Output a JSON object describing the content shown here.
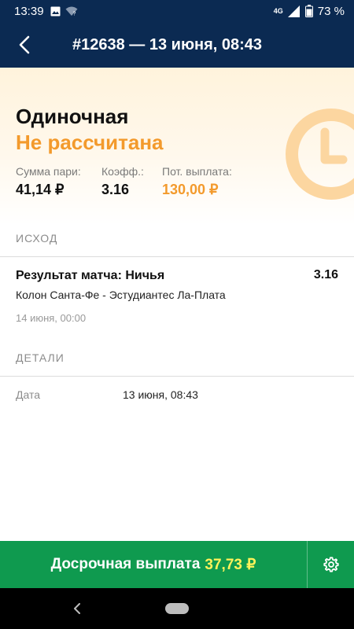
{
  "status_bar": {
    "time": "13:39",
    "network": "4G",
    "battery": "73 %"
  },
  "header": {
    "title": "#12638 — 13 июня, 08:43",
    "back_icon": "arrow-left-icon"
  },
  "bet": {
    "type": "Одиночная",
    "status": "Не рассчитана",
    "status_icon": "clock-icon",
    "stake_label": "Сумма пари:",
    "stake_value": "41,14 ₽",
    "odds_label": "Коэфф.:",
    "odds_value": "3.16",
    "payout_label": "Пот. выплата:",
    "payout_value": "130,00 ₽"
  },
  "outcome": {
    "section_title": "ИСХОД",
    "market": "Результат матча: Ничья",
    "odds": "3.16",
    "match": "Колон Санта-Фе - Эстудиантес Ла-Плата",
    "date": "14 июня, 00:00"
  },
  "details": {
    "section_title": "ДЕТАЛИ",
    "date_label": "Дата",
    "date_value": "13 июня, 08:43"
  },
  "cashout": {
    "label": "Досрочная выплата",
    "amount": "37,73 ₽",
    "settings_icon": "gear-icon"
  },
  "colors": {
    "header_bg": "#0b2a52",
    "accent_orange": "#f39a2c",
    "cashout_green": "#0f9a4f",
    "cashout_amount": "#fff35a"
  }
}
